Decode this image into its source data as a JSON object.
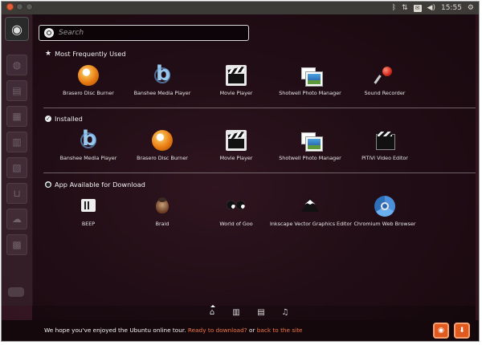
{
  "topbar": {
    "clock": "15:55",
    "tray_icons": [
      "bluetooth-icon",
      "network-icon",
      "mail-icon",
      "volume-icon",
      "gear-icon"
    ]
  },
  "launcher": {
    "items": [
      "ubuntu-logo-icon",
      "firefox-icon",
      "files-icon",
      "document-icon",
      "spreadsheet-icon",
      "presentation-icon",
      "software-center-icon",
      "ubuntu-one-icon",
      "workspaces-icon",
      "trash-icon"
    ]
  },
  "search": {
    "placeholder": "Search"
  },
  "sections": [
    {
      "title": "Most Frequently Used",
      "apps": [
        "Brasero Disc Burner",
        "Banshee Media Player",
        "Movie Player",
        "Shotwell Photo Manager",
        "Sound Recorder"
      ]
    },
    {
      "title": "Installed",
      "apps": [
        "Banshee Media Player",
        "Brasero Disc Burner",
        "Movie Player",
        "Shotwell Photo Manager",
        "PiTiVi Video Editor"
      ]
    },
    {
      "title": "App Available for Download",
      "apps": [
        "BEEP",
        "Braid",
        "World of Goo",
        "Inkscape Vector Graphics Editor",
        "Chromium Web Browser"
      ]
    }
  ],
  "lenses": [
    "home-lens-icon",
    "applications-lens-icon",
    "files-lens-icon",
    "music-lens-icon"
  ],
  "footer": {
    "message": "We hope you've enjoyed the Ubuntu online tour.",
    "download_link": "Ready to download?",
    "or_text": "or",
    "back_link": "back to the site",
    "accent": "#f07746"
  }
}
